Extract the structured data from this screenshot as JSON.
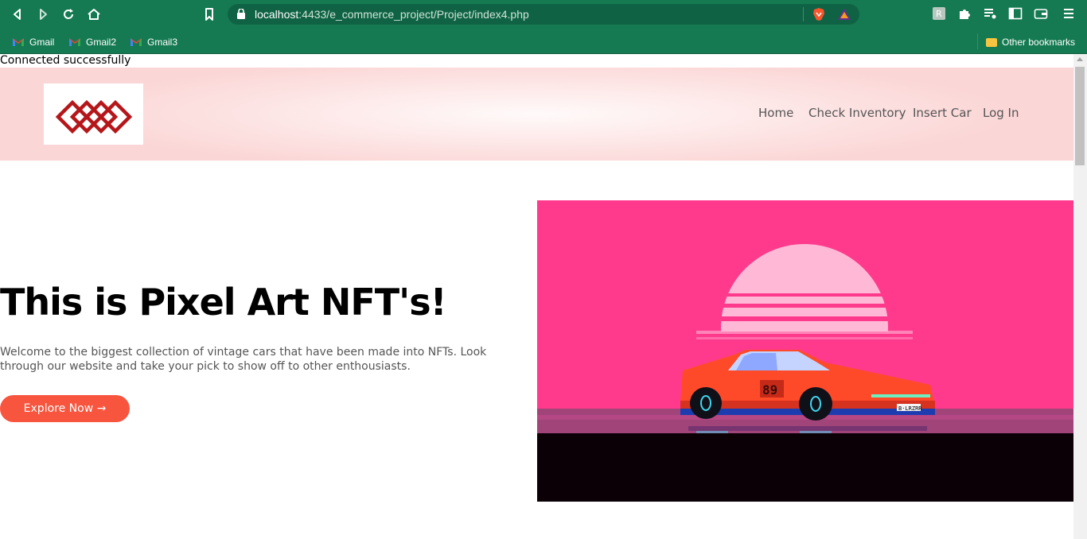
{
  "browser": {
    "url_host": "localhost",
    "url_path": ":4433/e_commerce_project/Project/index4.php",
    "bookmarks": [
      "Gmail",
      "Gmail2",
      "Gmail3"
    ],
    "other_bookmarks": "Other bookmarks"
  },
  "page": {
    "status_message": "Connected successfully",
    "nav": [
      "Home",
      "Check Inventory",
      "Insert Car",
      "Log In"
    ],
    "hero": {
      "title": "This is Pixel Art NFT's!",
      "text": "Welcome to the biggest collection of vintage cars that have been made into NFTs. Look through our website and take your pick to show off to other enthousiasts.",
      "cta": "Explore Now →"
    },
    "car_number": "89",
    "plate": "B·LRZRR"
  },
  "colors": {
    "chrome": "#157a52",
    "accent": "#f8553f",
    "logo_red": "#b5161a",
    "art_pink": "#ff3a8c"
  },
  "icons": [
    "back-icon",
    "forward-icon",
    "reload-icon",
    "home-icon",
    "bookmark-icon",
    "lock-icon",
    "brave-icon",
    "triangle-icon",
    "extension-icon",
    "puzzle-icon",
    "playlist-icon",
    "sidebar-icon",
    "wallet-icon",
    "menu-icon",
    "folder-icon"
  ]
}
